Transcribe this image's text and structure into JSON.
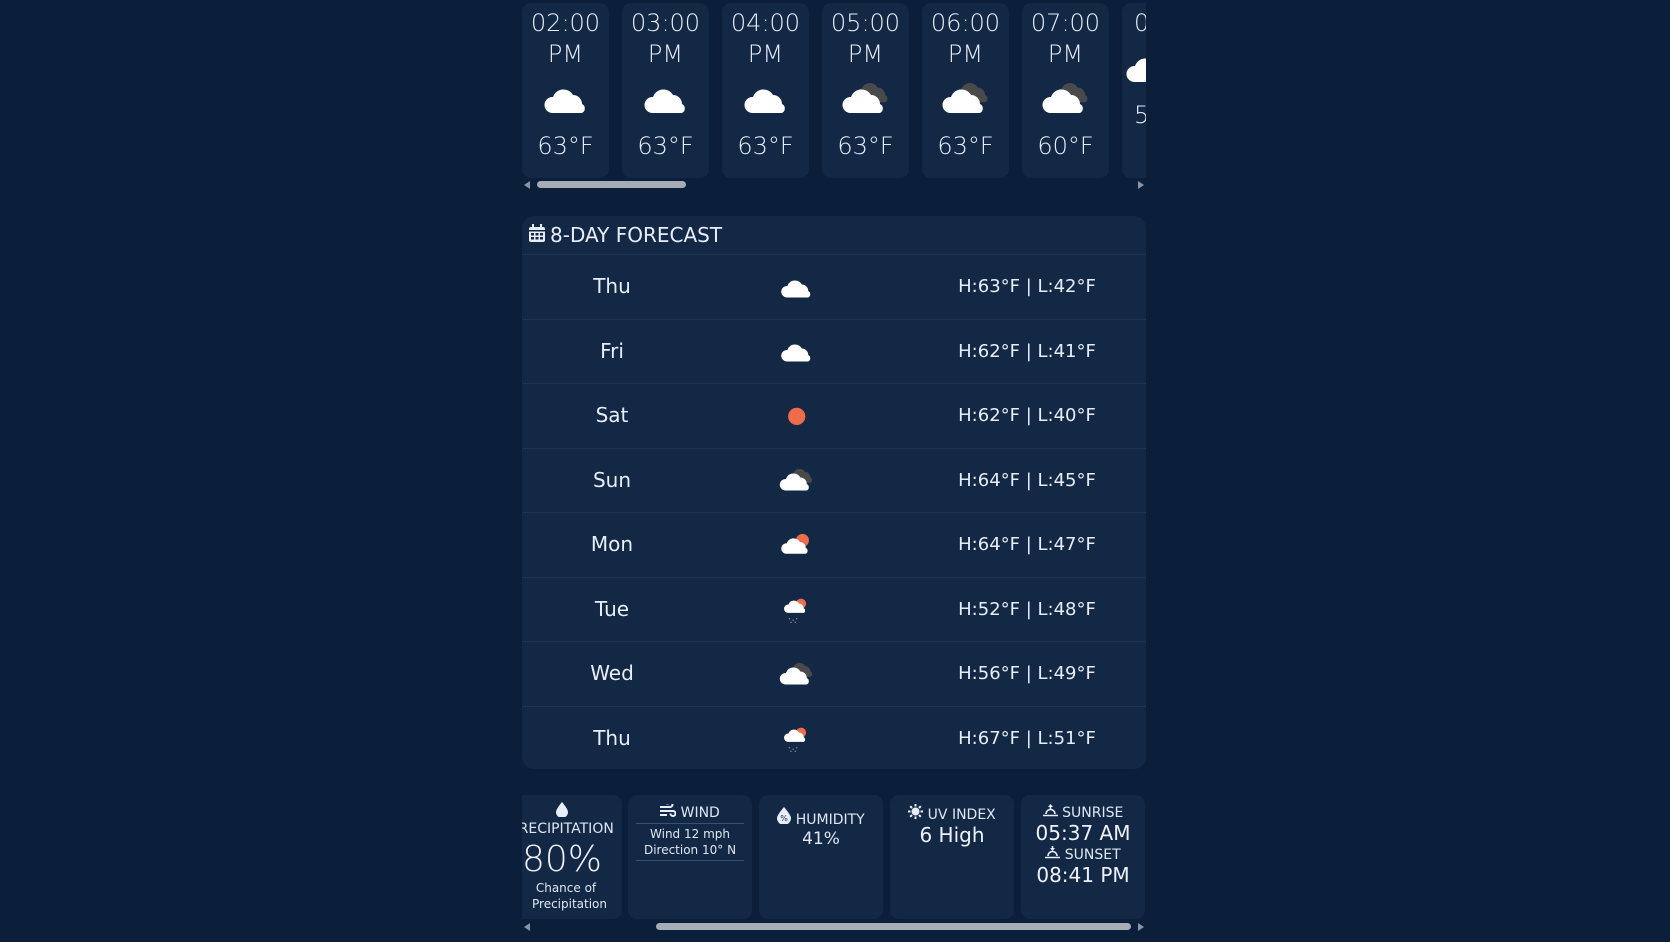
{
  "hourly": [
    {
      "time": "02:00",
      "ampm": "PM",
      "icon": "cloud-icon",
      "temp": "63°F"
    },
    {
      "time": "03:00",
      "ampm": "PM",
      "icon": "cloud-icon",
      "temp": "63°F"
    },
    {
      "time": "04:00",
      "ampm": "PM",
      "icon": "cloud-icon",
      "temp": "63°F"
    },
    {
      "time": "05:00",
      "ampm": "PM",
      "icon": "broken-clouds-icon",
      "temp": "63°F"
    },
    {
      "time": "06:00",
      "ampm": "PM",
      "icon": "broken-clouds-icon",
      "temp": "63°F"
    },
    {
      "time": "07:00",
      "ampm": "PM",
      "icon": "broken-clouds-icon",
      "temp": "60°F"
    },
    {
      "time": "0",
      "ampm": "",
      "icon": "cloud-icon",
      "temp": "5"
    }
  ],
  "daily": {
    "title": "8-DAY FORECAST",
    "days": [
      {
        "day": "Thu",
        "icon": "cloud-icon",
        "temp": "H:63°F | L:42°F"
      },
      {
        "day": "Fri",
        "icon": "cloud-icon",
        "temp": "H:62°F | L:41°F"
      },
      {
        "day": "Sat",
        "icon": "sun-icon",
        "temp": "H:62°F | L:40°F"
      },
      {
        "day": "Sun",
        "icon": "broken-clouds-icon",
        "temp": "H:64°F | L:45°F"
      },
      {
        "day": "Mon",
        "icon": "partly-cloudy-icon",
        "temp": "H:64°F | L:47°F"
      },
      {
        "day": "Tue",
        "icon": "sun-rain-icon",
        "temp": "H:52°F | L:48°F"
      },
      {
        "day": "Wed",
        "icon": "broken-clouds-icon",
        "temp": "H:56°F | L:49°F"
      },
      {
        "day": "Thu",
        "icon": "sun-rain-icon",
        "temp": "H:67°F | L:51°F"
      }
    ]
  },
  "details": {
    "precipitation": {
      "title": "PRECIPITATION",
      "value": "80%",
      "caption": "Chance of Precipitation"
    },
    "wind": {
      "title": "WIND",
      "speed": "Wind 12 mph",
      "direction": "Direction 10° N"
    },
    "humidity": {
      "title": "HUMIDITY",
      "value": "41%"
    },
    "uv": {
      "title": "UV INDEX",
      "value": "6 High"
    },
    "sun": {
      "sunrise_title": "SUNRISE",
      "sunrise": "05:37 AM",
      "sunset_title": "SUNSET",
      "sunset": "08:41 PM"
    }
  },
  "colors": {
    "background": "#0b1e3a",
    "card": "#132845",
    "sun": "#ef6b4a",
    "cloud": "#ffffff",
    "dark_cloud": "#4a4a4a"
  }
}
